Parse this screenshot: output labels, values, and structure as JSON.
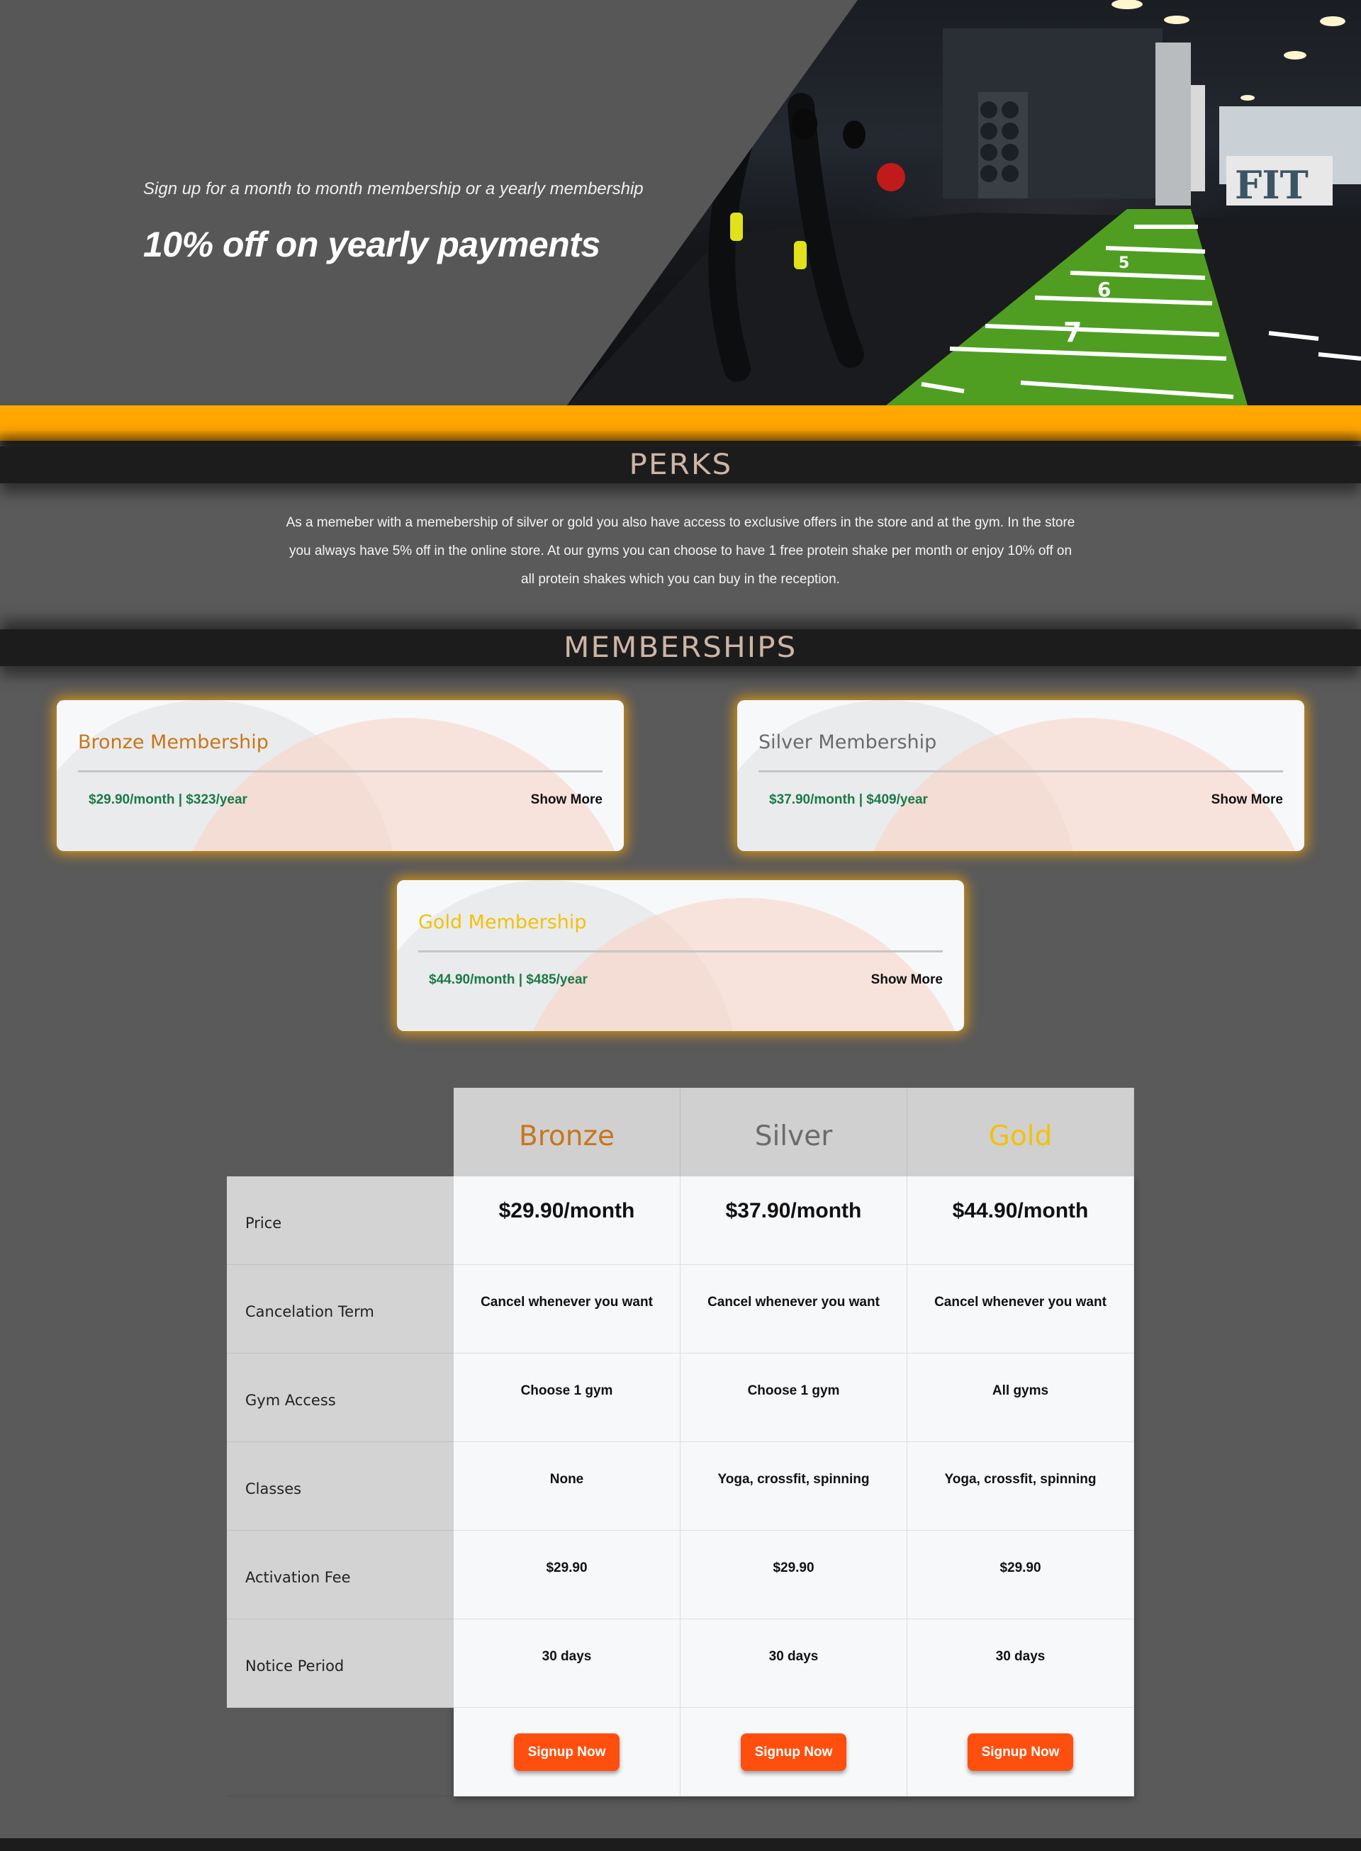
{
  "hero": {
    "subtitle": "Sign up for a month to month membership or a yearly membership",
    "headline": "10% off on yearly payments",
    "photo_sign": "FIT",
    "track_numbers": [
      "7",
      "6",
      "5"
    ]
  },
  "perks": {
    "heading": "PERKS",
    "text": "As a memeber with a memebership of silver or gold you also have access to exclusive offers in the store and at the gym. In the store you always have 5% off in the online store. At our gyms you can choose to have 1 free protein shake per month or enjoy 10% off on all protein shakes which you can buy in the reception."
  },
  "memberships": {
    "heading": "MEMBERSHIPS",
    "cards": [
      {
        "title": "Bronze Membership",
        "price": "$29.90/month | $323/year",
        "action": "Show More",
        "title_color": "#c8761a"
      },
      {
        "title": "Silver Membership",
        "price": "$37.90/month | $409/year",
        "action": "Show More",
        "title_color": "#6b6b6b"
      },
      {
        "title": "Gold Membership",
        "price": "$44.90/month | $485/year",
        "action": "Show More",
        "title_color": "#f2c10a"
      }
    ]
  },
  "comparison": {
    "columns": [
      {
        "name": "Bronze",
        "color": "#c8761a"
      },
      {
        "name": "Silver",
        "color": "#6b6b6b"
      },
      {
        "name": "Gold",
        "color": "#f2c10a"
      }
    ],
    "rows": [
      {
        "label": "Price",
        "values": [
          "$29.90/month",
          "$37.90/month",
          "$44.90/month"
        ]
      },
      {
        "label": "Cancelation Term",
        "values": [
          "Cancel whenever you want",
          "Cancel whenever you want",
          "Cancel whenever you want"
        ]
      },
      {
        "label": "Gym Access",
        "values": [
          "Choose 1 gym",
          "Choose 1 gym",
          "All gyms"
        ]
      },
      {
        "label": "Classes",
        "values": [
          "None",
          "Yoga, crossfit, spinning",
          "Yoga, crossfit, spinning"
        ]
      },
      {
        "label": "Activation Fee",
        "values": [
          "$29.90",
          "$29.90",
          "$29.90"
        ]
      },
      {
        "label": "Notice Period",
        "values": [
          "30 days",
          "30 days",
          "30 days"
        ]
      }
    ],
    "signup_label": "Signup Now"
  },
  "colors": {
    "accent_orange": "#ffa500",
    "signup_button": "#ff4f0f",
    "price_green": "#1b7a47"
  }
}
